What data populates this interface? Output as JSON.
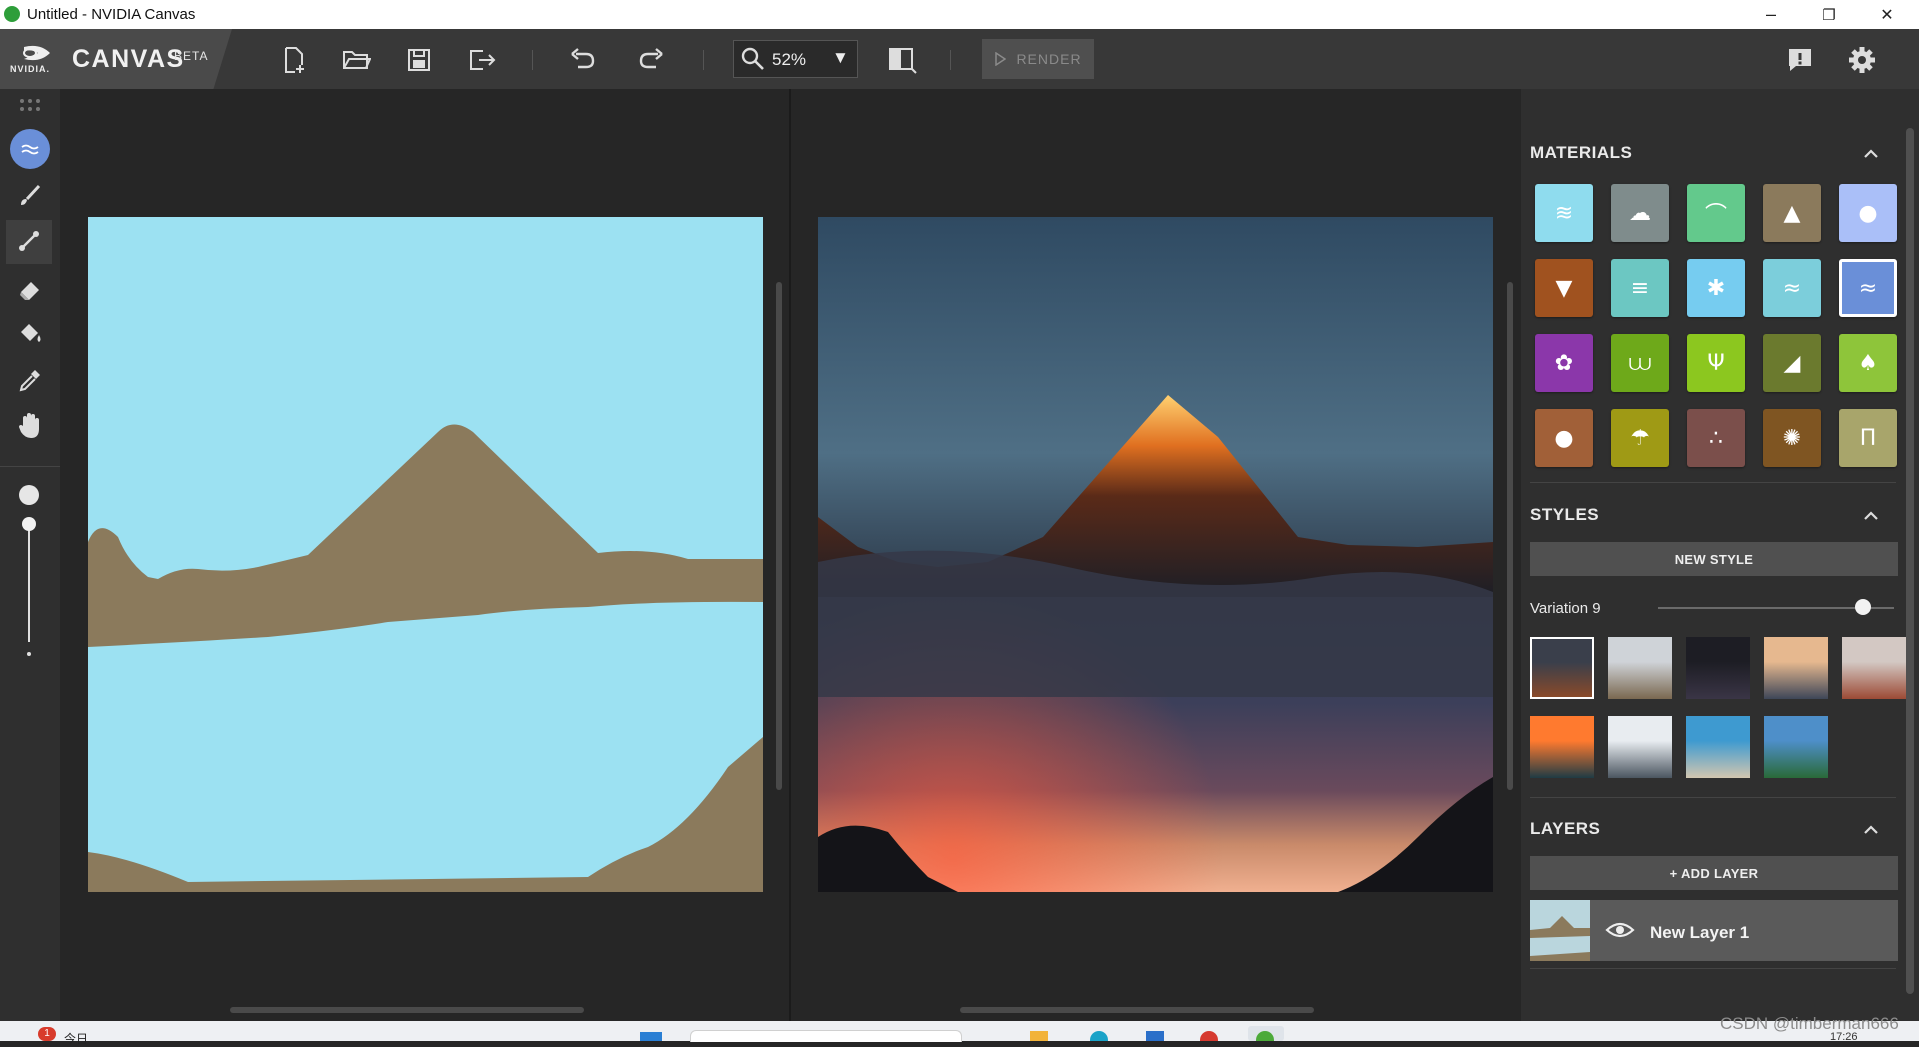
{
  "window": {
    "title": "Untitled - NVIDIA Canvas",
    "minimize": "–",
    "restore": "❐",
    "close": "✕"
  },
  "brand": {
    "logo_text": "NVIDIA.",
    "app_name": "CANVAS",
    "badge": "BETA"
  },
  "toolbar": {
    "buttons": [
      "new-file-icon",
      "open-folder-icon",
      "save-icon",
      "export-icon",
      "undo-icon",
      "redo-icon"
    ],
    "zoom": {
      "icon": "magnifier-icon",
      "value": "52%",
      "dropdown": "▼"
    },
    "compare_icon": "split-view-icon",
    "render_label": "RENDER",
    "feedback_icon": "feedback-icon",
    "settings_icon": "gear-icon"
  },
  "tools": [
    "grid-handle-icon",
    "material-brush-icon",
    "brush-icon",
    "line-icon",
    "eraser-icon",
    "fill-bucket-icon",
    "eyedropper-icon",
    "pan-hand-icon"
  ],
  "panel": {
    "materials_title": "MATERIALS",
    "materials": [
      {
        "name": "sea",
        "color": "#8fdcee"
      },
      {
        "name": "cloud",
        "color": "#7f8c8c"
      },
      {
        "name": "hill",
        "color": "#63c98c"
      },
      {
        "name": "mountain",
        "color": "#8b7a5c"
      },
      {
        "name": "water-drop",
        "color": "#aabff8"
      },
      {
        "name": "dirt",
        "color": "#a0521f"
      },
      {
        "name": "fog",
        "color": "#6cc7c2"
      },
      {
        "name": "snow",
        "color": "#76ccf0"
      },
      {
        "name": "river",
        "color": "#7ccedb"
      },
      {
        "name": "water",
        "color": "#6a8fd8"
      },
      {
        "name": "flower",
        "color": "#8b37aa"
      },
      {
        "name": "grass",
        "color": "#6ea91a"
      },
      {
        "name": "tall-grass",
        "color": "#8cc71f"
      },
      {
        "name": "rock",
        "color": "#6b7a2e"
      },
      {
        "name": "tree",
        "color": "#8ec53a"
      },
      {
        "name": "stone",
        "color": "#a16038"
      },
      {
        "name": "palm",
        "color": "#9f9a15"
      },
      {
        "name": "gravel",
        "color": "#7b4f4b"
      },
      {
        "name": "wood",
        "color": "#7f5522"
      },
      {
        "name": "platform",
        "color": "#a8a56b"
      }
    ],
    "selected_material_index": 9,
    "styles_title": "STYLES",
    "new_style_label": "NEW STYLE",
    "variation_label": "Variation 9",
    "variation_level": 0.87,
    "style_thumbs": [
      {
        "name": "desert-mesa",
        "top": "#3a3f4b",
        "bottom": "#8a4a2a"
      },
      {
        "name": "misty-peaks",
        "top": "#cfd3d8",
        "bottom": "#7a6850"
      },
      {
        "name": "dark-arch",
        "top": "#1d1d24",
        "bottom": "#3a3546"
      },
      {
        "name": "cloud-sea",
        "top": "#e6b88f",
        "bottom": "#3e4658"
      },
      {
        "name": "red-cliff",
        "top": "#d3c8c3",
        "bottom": "#9c4a35"
      },
      {
        "name": "ocean-sunset",
        "top": "#ff7a2f",
        "bottom": "#1f3b44"
      },
      {
        "name": "snowy-ridge",
        "top": "#e8ecf0",
        "bottom": "#4b5660"
      },
      {
        "name": "coast",
        "top": "#3e9ad0",
        "bottom": "#d2c6b0"
      },
      {
        "name": "alpine-lake",
        "top": "#4e8fc9",
        "bottom": "#2a6a38"
      }
    ],
    "layers_title": "LAYERS",
    "add_layer_label": "+ ADD LAYER",
    "layer": {
      "name": "New Layer 1",
      "visibility_icon": "eye-icon"
    },
    "collapse_icon": "chevron-up-icon"
  },
  "taskbar": {
    "notification_count": "1",
    "today_label": "今日",
    "clock": "17:26",
    "watermark": "CSDN @timberman666"
  }
}
